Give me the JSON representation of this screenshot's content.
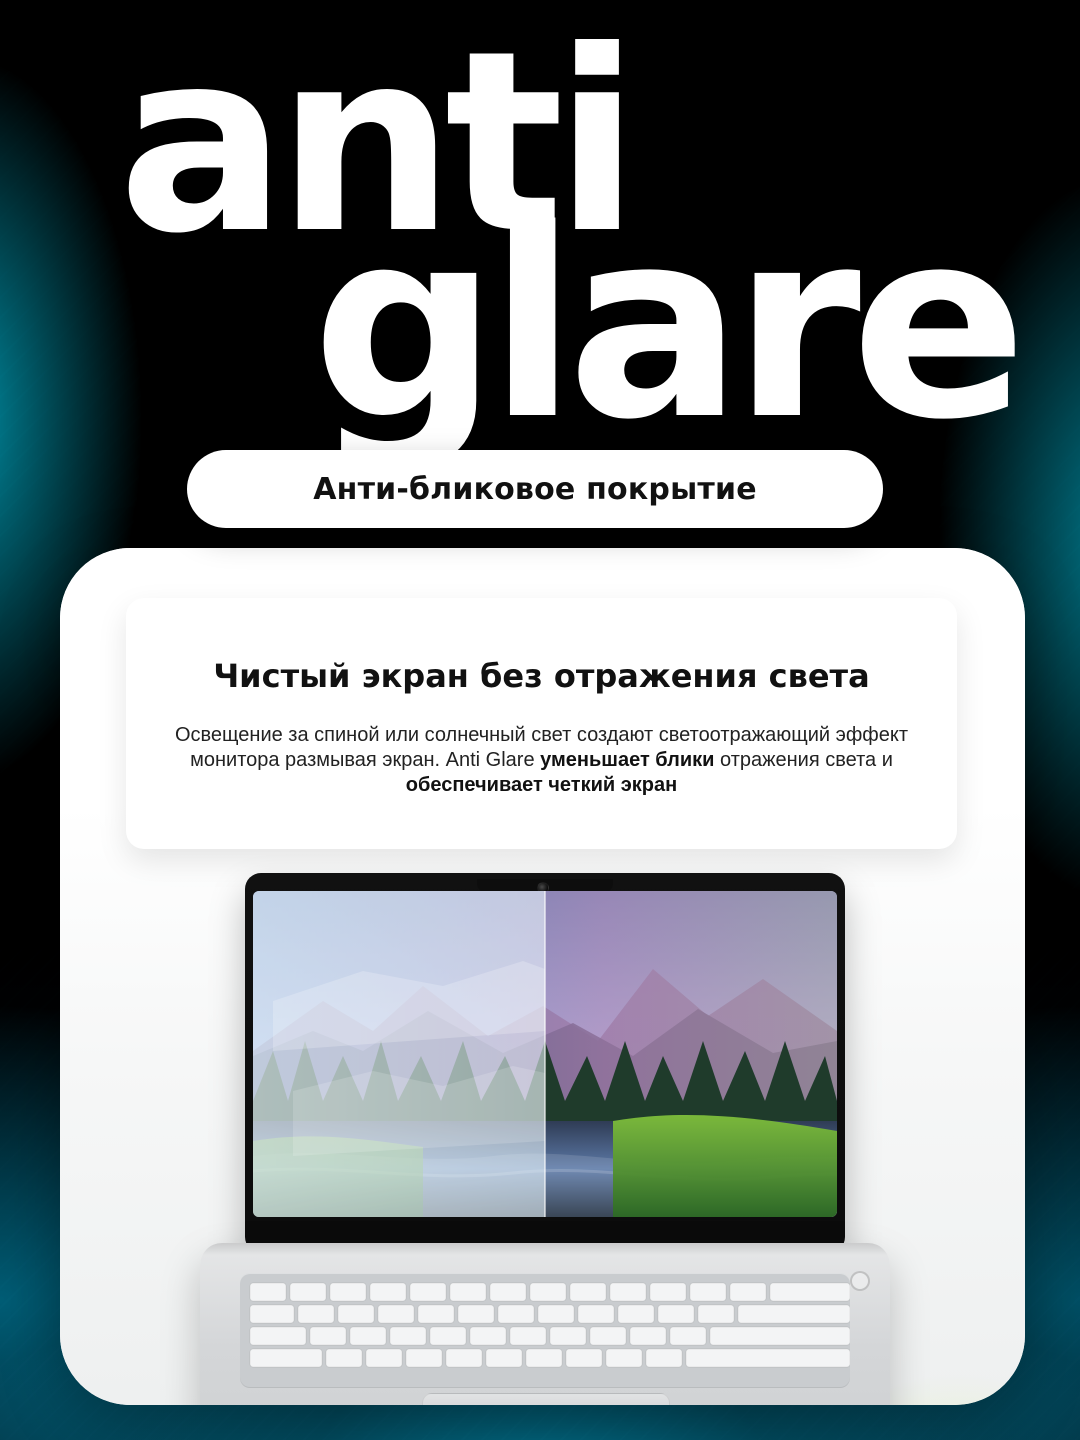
{
  "headline": {
    "line1": "anti",
    "line2": "glare"
  },
  "pill": {
    "label": "Анти-бликовое покрытие"
  },
  "info_card": {
    "title": "Чистый экран без отражения света",
    "body": {
      "p1": "Освещение за спиной или солнечный свет создают светоотражающий эффект монитора размывая экран. Anti Glare ",
      "strong1": "уменьшает блики",
      "p2": " отражения света и ",
      "strong2": "обеспечивает четкий экран"
    }
  },
  "colors": {
    "background": "#000000",
    "accent_cyan": "#00DCFF",
    "card_white": "#FFFFFF",
    "text_dark": "#111111"
  },
  "icons": {
    "webcam": "webcam-icon",
    "power": "power-icon"
  }
}
